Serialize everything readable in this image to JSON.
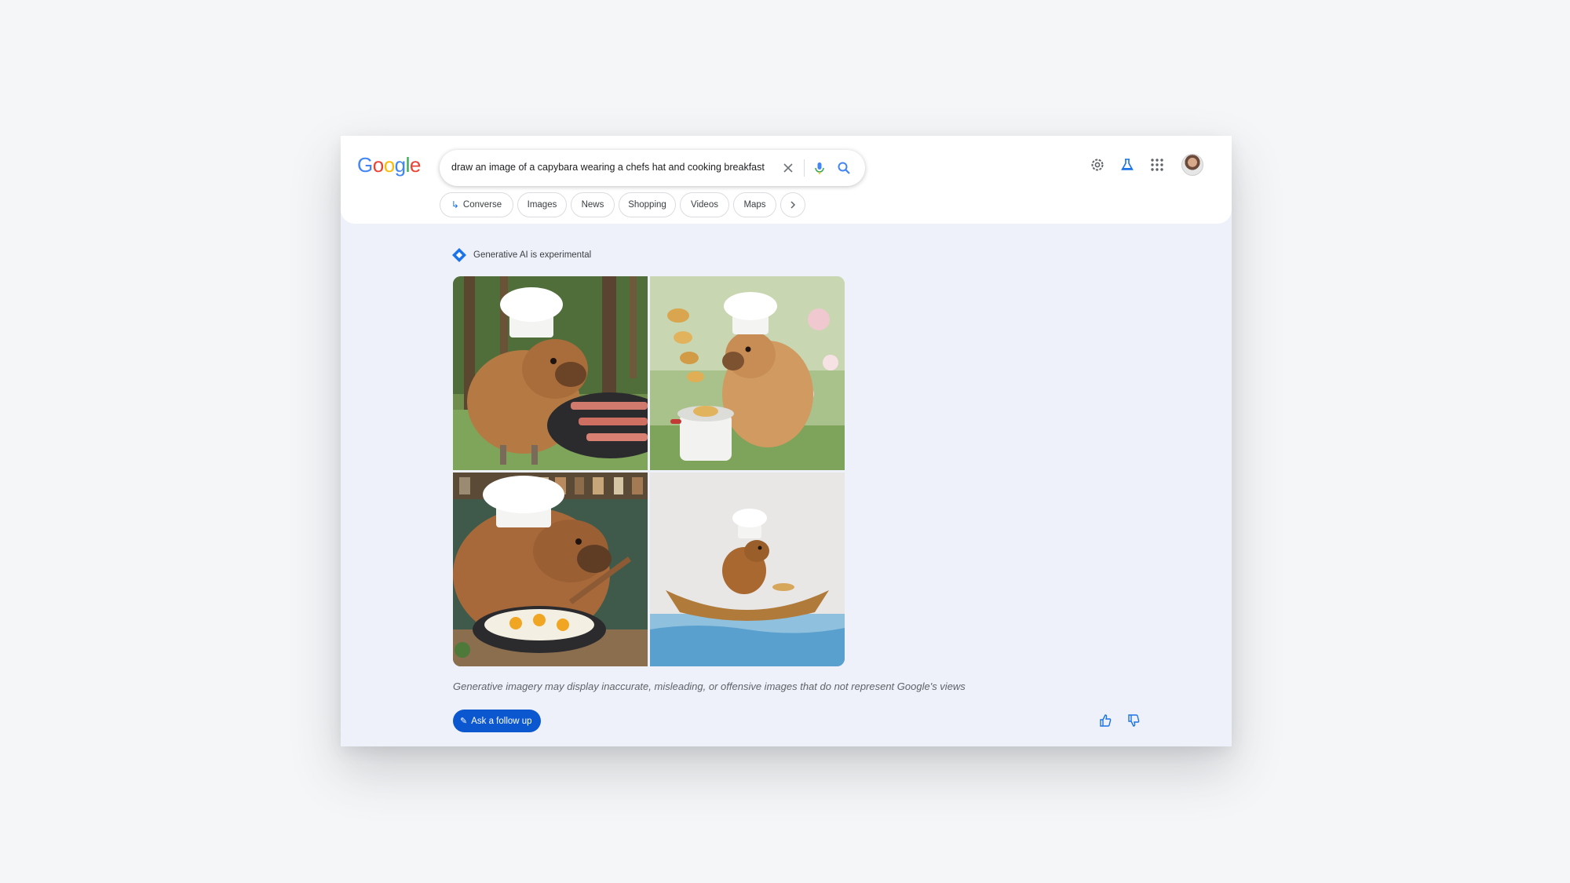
{
  "header": {
    "logo": [
      "G",
      "o",
      "o",
      "g",
      "l",
      "e"
    ],
    "logo_colors": [
      "#4285f4",
      "#ea4335",
      "#fbbc05",
      "#4285f4",
      "#34a853",
      "#ea4335"
    ],
    "search": {
      "query": "draw an image of a capybara wearing a chefs hat and cooking breakfast",
      "icons": [
        "close-icon",
        "mic-icon",
        "search-icon"
      ]
    },
    "right_icons": [
      "settings-gear-icon",
      "labs-flask-icon",
      "apps-grid-icon",
      "avatar"
    ],
    "chips": [
      {
        "label": "Converse",
        "icon": "return-arrow-icon"
      },
      {
        "label": "Images"
      },
      {
        "label": "News"
      },
      {
        "label": "Shopping"
      },
      {
        "label": "Videos"
      },
      {
        "label": "Maps"
      }
    ]
  },
  "result": {
    "ai_label": "Generative AI is experimental",
    "images": [
      {
        "alt": "capybara in chef hat grilling bacon in forest"
      },
      {
        "alt": "capybara in chef hat flipping pancakes over pot in garden"
      },
      {
        "alt": "capybara in chef hat frying eggs in pan in kitchen"
      },
      {
        "alt": "capybara in chef hat cooking in a boat on water"
      }
    ],
    "disclaimer": "Generative imagery may display inaccurate, misleading, or offensive images that do not represent Google's views",
    "follow_up_label": "Ask a follow up",
    "feedback_icons": [
      "thumbs-up-icon",
      "thumbs-down-icon"
    ]
  },
  "colors": {
    "accent": "#0b57d0",
    "page_bg": "#f5f6f8",
    "panel_bg": "#eef1f9"
  }
}
